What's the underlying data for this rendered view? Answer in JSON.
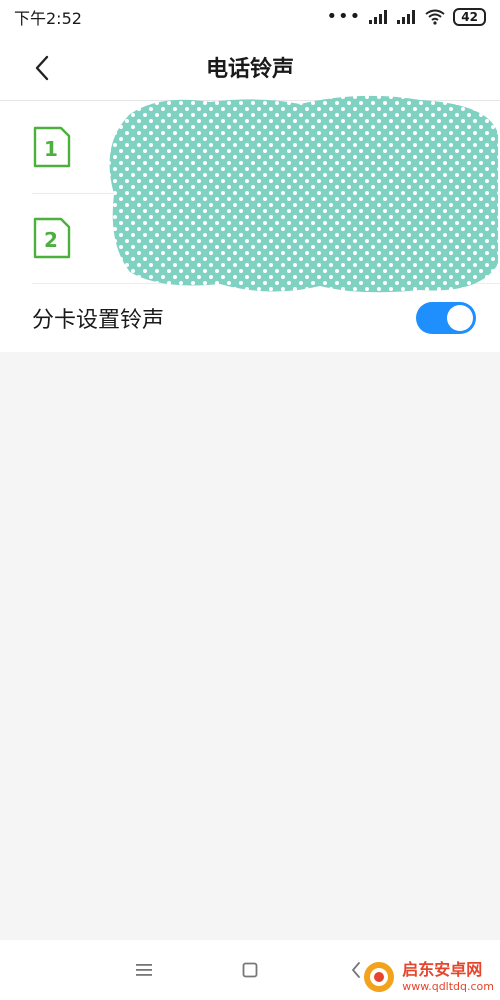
{
  "status_bar": {
    "time": "下午2:52",
    "signal_dots": "•••",
    "battery": "42"
  },
  "header": {
    "title": "电话铃声"
  },
  "sims": [
    {
      "label": "1"
    },
    {
      "label": "2"
    }
  ],
  "split_ringtone": {
    "label": "分卡设置铃声",
    "enabled": true
  },
  "watermark": {
    "name": "启东安卓网",
    "url": "www.qdltdq.com"
  },
  "colors": {
    "accent": "#1e8ffc",
    "sim_green": "#4caf3e",
    "redaction": "#7fd1c1"
  }
}
